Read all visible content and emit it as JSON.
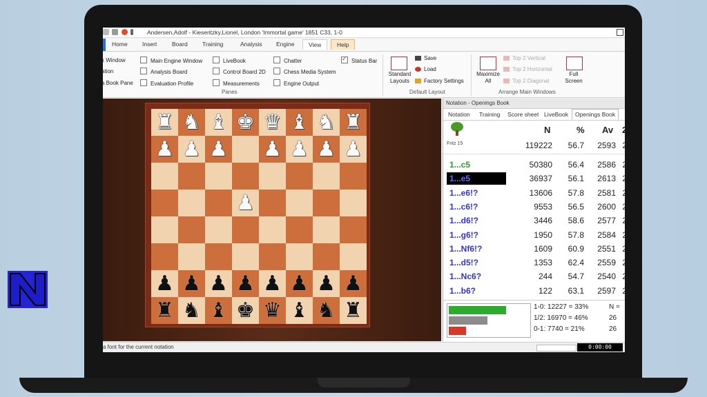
{
  "window": {
    "title": "Andersen,Adolf - Kieseritzky,Lionel, London 'Immortal game' 1851  C33, 1-0"
  },
  "menu_tabs": [
    "Home",
    "Insert",
    "Board",
    "Training",
    "Analysis",
    "Engine",
    "View",
    "Help"
  ],
  "active_tab": "View",
  "ribbon": {
    "panes": {
      "col1": [
        "k Window",
        "ation",
        "a Book Pane"
      ],
      "col2": [
        "Main Engine Window",
        "Analysis Board",
        "Evaluation Profile"
      ],
      "col3": [
        "LiveBook",
        "Control Board 2D",
        "Measurements"
      ],
      "col4": [
        "Chatter",
        "Chess Media System",
        "Engine Output"
      ],
      "status_bar": "Status Bar",
      "group_label": "Panes"
    },
    "default_layout": {
      "standard": "Standard Layouts",
      "save": "Save",
      "load": "Load",
      "factory": "Factory Settings",
      "group_label": "Default Layout"
    },
    "arrange": {
      "maximize": "Maximize All",
      "top2vertical": "Top 2 Vertical",
      "top2horizontal": "Top 2 Horizontal",
      "top2diagonal": "Top 2 Diagonal",
      "fullscreen": "Full Screen",
      "group_label": "Arrange Main Windows"
    }
  },
  "board": {
    "ranks": [
      [
        "♜",
        "♞",
        "♝",
        "♚",
        "♛",
        "♝",
        "♞",
        "♜"
      ],
      [
        "♟",
        "♟",
        "♟",
        "",
        "♟",
        "♟",
        "♟",
        "♟"
      ],
      [
        "",
        "",
        "",
        "",
        "",
        "",
        "",
        ""
      ],
      [
        "",
        "",
        "",
        "♟",
        "",
        "",
        "",
        ""
      ],
      [
        "",
        "",
        "",
        "",
        "",
        "",
        "",
        ""
      ],
      [
        "",
        "",
        "",
        "",
        "",
        "",
        "",
        ""
      ],
      [
        "♟",
        "♟",
        "♟",
        "♟",
        "♟",
        "♟",
        "♟",
        "♟"
      ],
      [
        "♜",
        "♞",
        "♝",
        "♚",
        "♛",
        "♝",
        "♞",
        "♜"
      ]
    ],
    "colors": [
      [
        "w",
        "w",
        "w",
        "w",
        "w",
        "w",
        "w",
        "w"
      ],
      [
        "w",
        "w",
        "w",
        "",
        "w",
        "w",
        "w",
        "w"
      ],
      [
        "",
        "",
        "",
        "",
        "",
        "",
        "",
        ""
      ],
      [
        "",
        "",
        "",
        "w",
        "",
        "",
        "",
        ""
      ],
      [
        "",
        "",
        "",
        "",
        "",
        "",
        "",
        ""
      ],
      [
        "",
        "",
        "",
        "",
        "",
        "",
        "",
        ""
      ],
      [
        "b",
        "b",
        "b",
        "b",
        "b",
        "b",
        "b",
        "b"
      ],
      [
        "b",
        "b",
        "b",
        "b",
        "b",
        "b",
        "b",
        "b"
      ]
    ]
  },
  "panel": {
    "title": "Notation - Openings Book",
    "tabs": [
      "Notation",
      "Training",
      "Score sheet",
      "LiveBook",
      "Openings Book"
    ],
    "active_tab": "Openings Book",
    "engine_label": "Fritz 15",
    "headers": {
      "n": "N",
      "pct": "%",
      "av": "Av",
      "cut": "2"
    },
    "summary": {
      "n": "119222",
      "pct": "56.7",
      "av": "2593",
      "cut": "2"
    },
    "moves": [
      {
        "move": "1...c5",
        "n": "50380",
        "pct": "56.4",
        "av": "2586",
        "cut": "2",
        "style": "green"
      },
      {
        "move": "1...e5",
        "n": "36937",
        "pct": "56.1",
        "av": "2613",
        "cut": "2",
        "style": "selected"
      },
      {
        "move": "1...e6!?",
        "n": "13606",
        "pct": "57.8",
        "av": "2581",
        "cut": "2",
        "style": "blue"
      },
      {
        "move": "1...c6!?",
        "n": "9553",
        "pct": "56.5",
        "av": "2600",
        "cut": "2",
        "style": "blue"
      },
      {
        "move": "1...d6!?",
        "n": "3446",
        "pct": "58.6",
        "av": "2577",
        "cut": "2",
        "style": "blue"
      },
      {
        "move": "1...g6!?",
        "n": "1950",
        "pct": "57.8",
        "av": "2584",
        "cut": "2",
        "style": "blue"
      },
      {
        "move": "1...Nf6!?",
        "n": "1609",
        "pct": "60.9",
        "av": "2551",
        "cut": "2",
        "style": "blue"
      },
      {
        "move": "1...d5!?",
        "n": "1353",
        "pct": "62.4",
        "av": "2559",
        "cut": "2",
        "style": "blue"
      },
      {
        "move": "1...Nc6?",
        "n": "244",
        "pct": "54.7",
        "av": "2540",
        "cut": "2",
        "style": "blue"
      },
      {
        "move": "1...b6?",
        "n": "122",
        "pct": "63.1",
        "av": "2597",
        "cut": "2",
        "style": "blue"
      }
    ],
    "stats": {
      "white": "1-0: 12227 = 33%",
      "draw": "1/2: 16970 = 46%",
      "black": "0-1: 7740 = 21%",
      "white_cut": "N =",
      "draw_cut": "26",
      "black_cut": "26",
      "white_frac": 0.33,
      "draw_frac": 0.46,
      "black_frac": 0.21
    }
  },
  "status": {
    "text": "a font for the current notation",
    "clock": "0:00:00"
  },
  "colors": {
    "accent": "#2a6fc9",
    "green": "#2e9a2e",
    "move_blue": "#3333cc",
    "logo": "#2424d6"
  }
}
